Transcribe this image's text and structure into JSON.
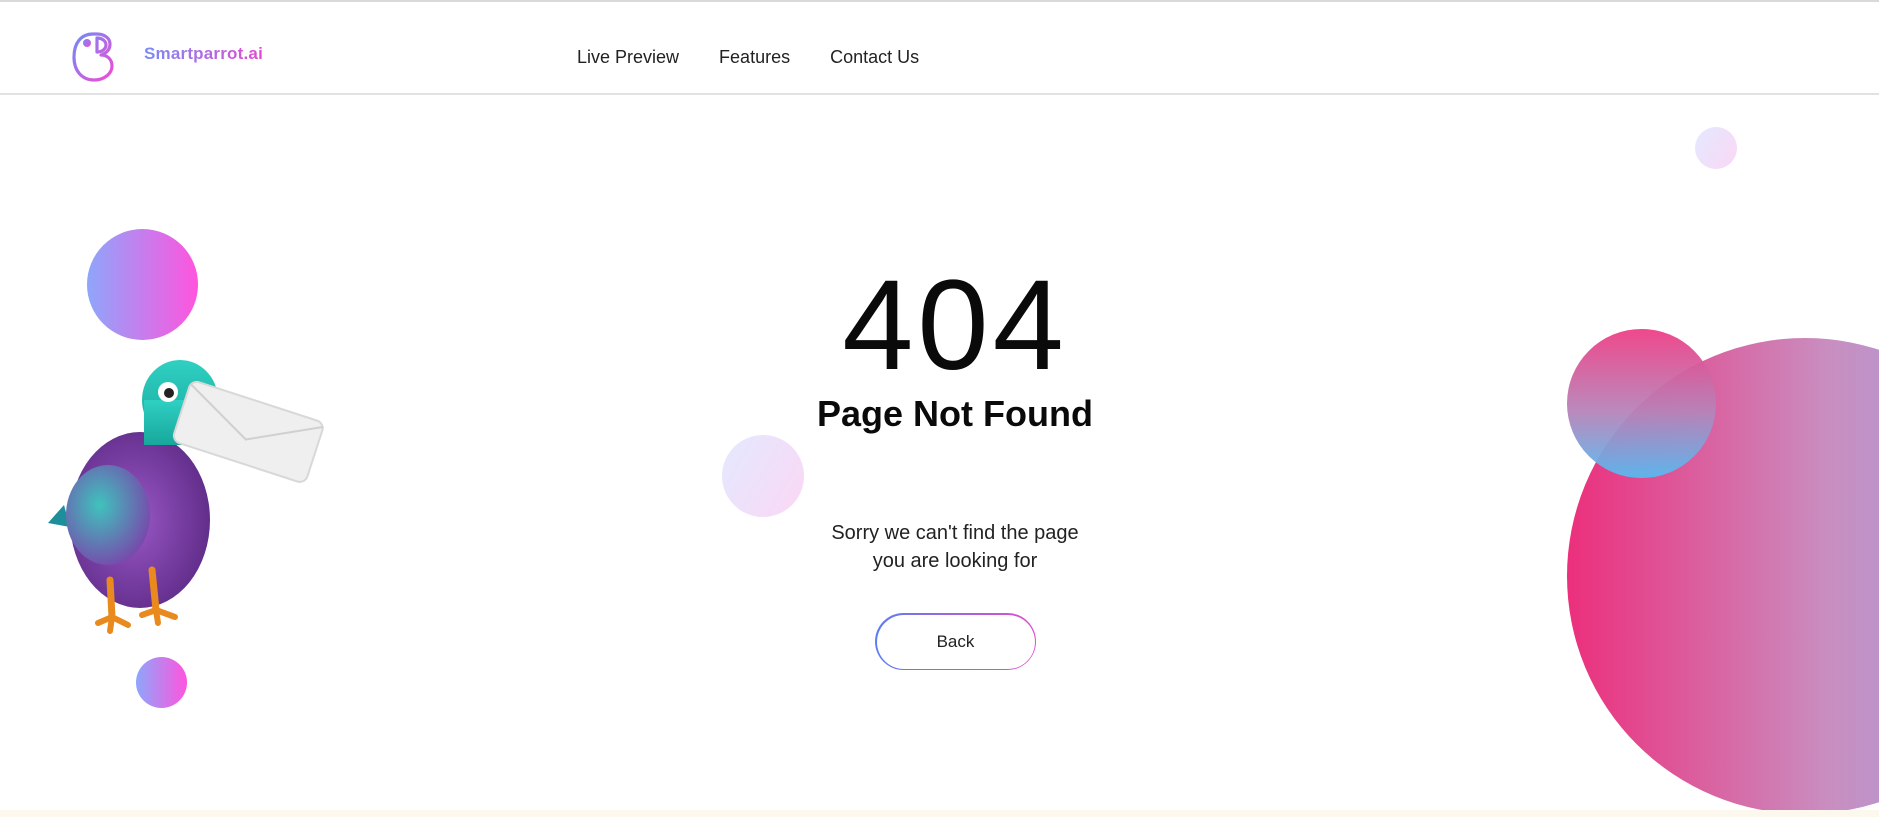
{
  "header": {
    "brand_name": "Smartparrot.ai",
    "logo_icon": "parrot-logo-icon",
    "nav": [
      {
        "label": "Live Preview"
      },
      {
        "label": "Features"
      },
      {
        "label": "Contact Us"
      }
    ]
  },
  "main": {
    "error_code": "404",
    "error_title": "Page Not Found",
    "message_line1": "Sorry we can't find the page",
    "message_line2": "you are looking for",
    "back_label": "Back",
    "illustration": "pigeon-with-envelope-illustration"
  },
  "colors": {
    "brand_gradient_start": "#7a8cf6",
    "brand_gradient_end": "#e14bd0",
    "accent_pink": "#ec2f7c",
    "accent_blue": "#58b9f0",
    "footer_strip": "#fdf8ee"
  }
}
